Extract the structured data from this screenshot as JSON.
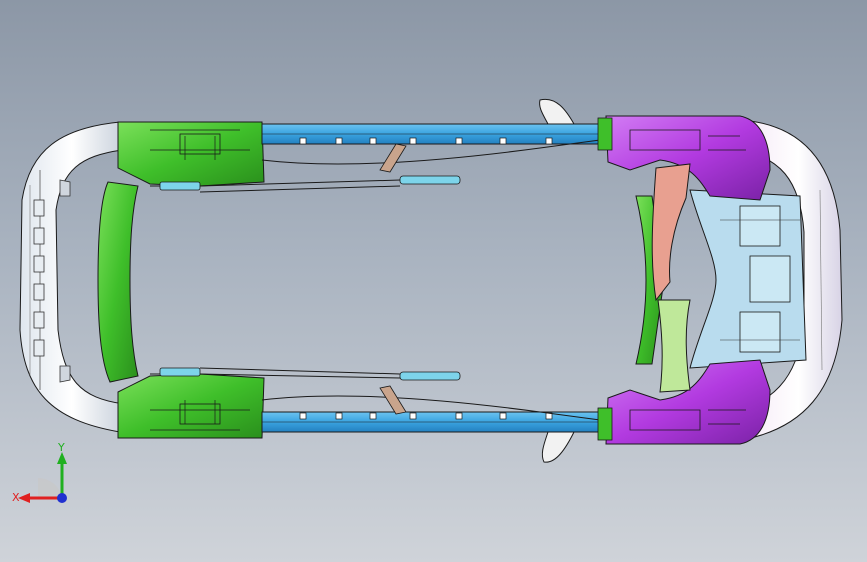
{
  "viewport": {
    "background_top": "#8c97a6",
    "background_bottom": "#cfd3d9"
  },
  "model": {
    "name": "vehicle-chassis-assembly",
    "colors": {
      "bumper": "#f0f2f6",
      "wheel_arch_front": "#3fbf2a",
      "wheel_arch_rear": "#b23ae0",
      "side_rail": "#3aa3e0",
      "crossmember": "#5fd13a",
      "tunnel": "#e8a090",
      "bracket": "#9ad7ee",
      "edges": "#1a1a1a"
    }
  },
  "triad": {
    "x_label": "X",
    "y_label": "Y",
    "x_color": "#e02020",
    "y_color": "#20b020",
    "z_color": "#2030d0"
  }
}
